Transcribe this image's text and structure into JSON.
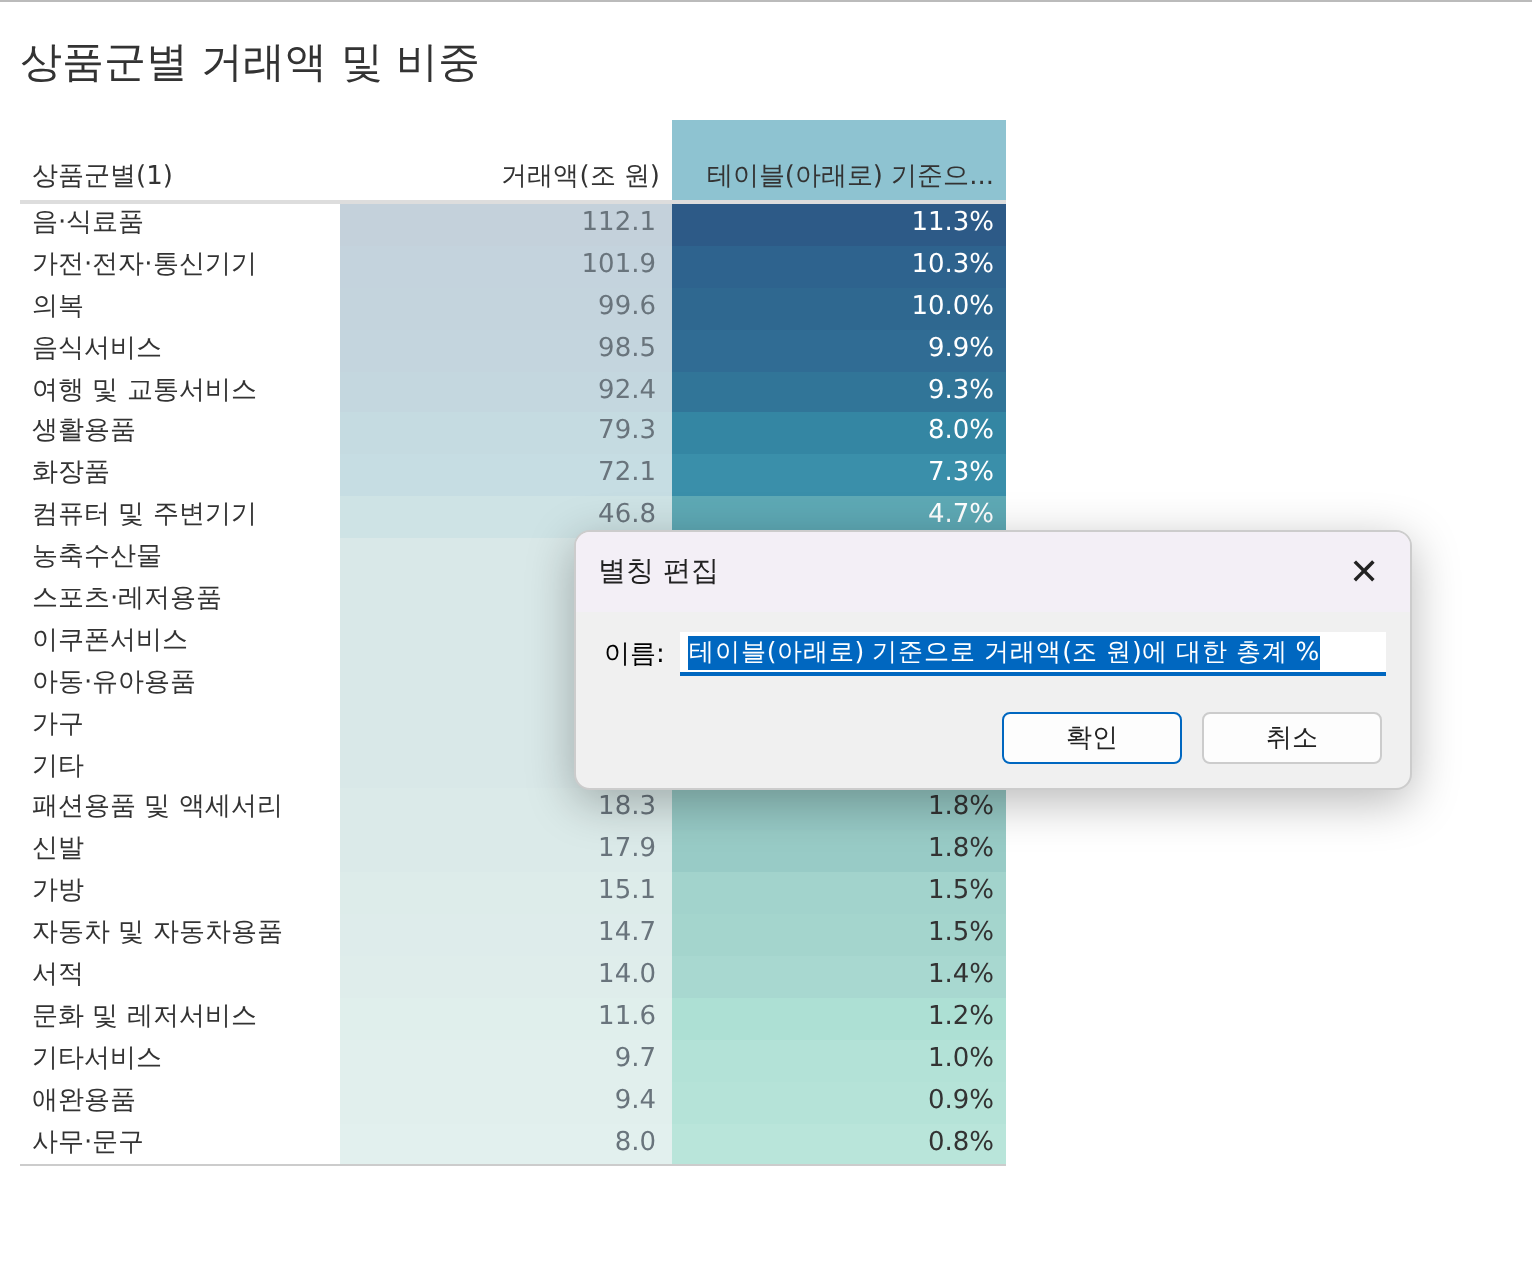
{
  "title": "상품군별 거래액 및 비중",
  "table": {
    "columns": [
      "상품군별(1)",
      "거래액(조 원)",
      "테이블(아래로) 기준으..."
    ],
    "rows": [
      {
        "category": "음·식료품",
        "amount": "112.1",
        "share": "11.3%",
        "color": "#2d5a87"
      },
      {
        "category": "가전·전자·통신기기",
        "amount": "101.9",
        "share": "10.3%",
        "color": "#2e638e"
      },
      {
        "category": "의복",
        "amount": "99.6",
        "share": "10.0%",
        "color": "#2f6890"
      },
      {
        "category": "음식서비스",
        "amount": "98.5",
        "share": "9.9%",
        "color": "#306c94"
      },
      {
        "category": "여행 및 교통서비스",
        "amount": "92.4",
        "share": "9.3%",
        "color": "#317598"
      },
      {
        "category": "생활용품",
        "amount": "79.3",
        "share": "8.0%",
        "color": "#3486a3"
      },
      {
        "category": "화장품",
        "amount": "72.1",
        "share": "7.3%",
        "color": "#3a8faa"
      },
      {
        "category": "컴퓨터 및 주변기기",
        "amount": "46.8",
        "share": "4.7%",
        "color": "#5ea9b5"
      },
      {
        "category": "농축수산물"
      },
      {
        "category": "스포츠·레저용품"
      },
      {
        "category": "이쿠폰서비스"
      },
      {
        "category": "아동·유아용품"
      },
      {
        "category": "가구"
      },
      {
        "category": "기타"
      },
      {
        "category": "패션용품 및 액세서리",
        "amount": "18.3",
        "share": "1.8%",
        "color": "#96c9c5"
      },
      {
        "category": "신발",
        "amount": "17.9",
        "share": "1.8%",
        "color": "#98cbc6"
      },
      {
        "category": "가방",
        "amount": "15.1",
        "share": "1.5%",
        "color": "#a2d3cc"
      },
      {
        "category": "자동차 및 자동차용품",
        "amount": "14.7",
        "share": "1.5%",
        "color": "#a4d5cd"
      },
      {
        "category": "서적",
        "amount": "14.0",
        "share": "1.4%",
        "color": "#a8d8d0"
      },
      {
        "category": "문화 및 레저서비스",
        "amount": "11.6",
        "share": "1.2%",
        "color": "#ade0d4"
      },
      {
        "category": "기타서비스",
        "amount": "9.7",
        "share": "1.0%",
        "color": "#b3e2d7"
      },
      {
        "category": "애완용품",
        "amount": "9.4",
        "share": "0.9%",
        "color": "#b5e3d8"
      },
      {
        "category": "사무·문구",
        "amount": "8.0",
        "share": "0.8%",
        "color": "#b9e5da"
      }
    ]
  },
  "dialog": {
    "title": "별칭 편집",
    "close": "✕",
    "field_label": "이름:",
    "value": "테이블(아래로) 기준으로 거래액(조 원)에 대한 총계 %",
    "buttons": [
      {
        "label": "확인",
        "default": true
      },
      {
        "label": "취소",
        "default": false
      }
    ]
  }
}
